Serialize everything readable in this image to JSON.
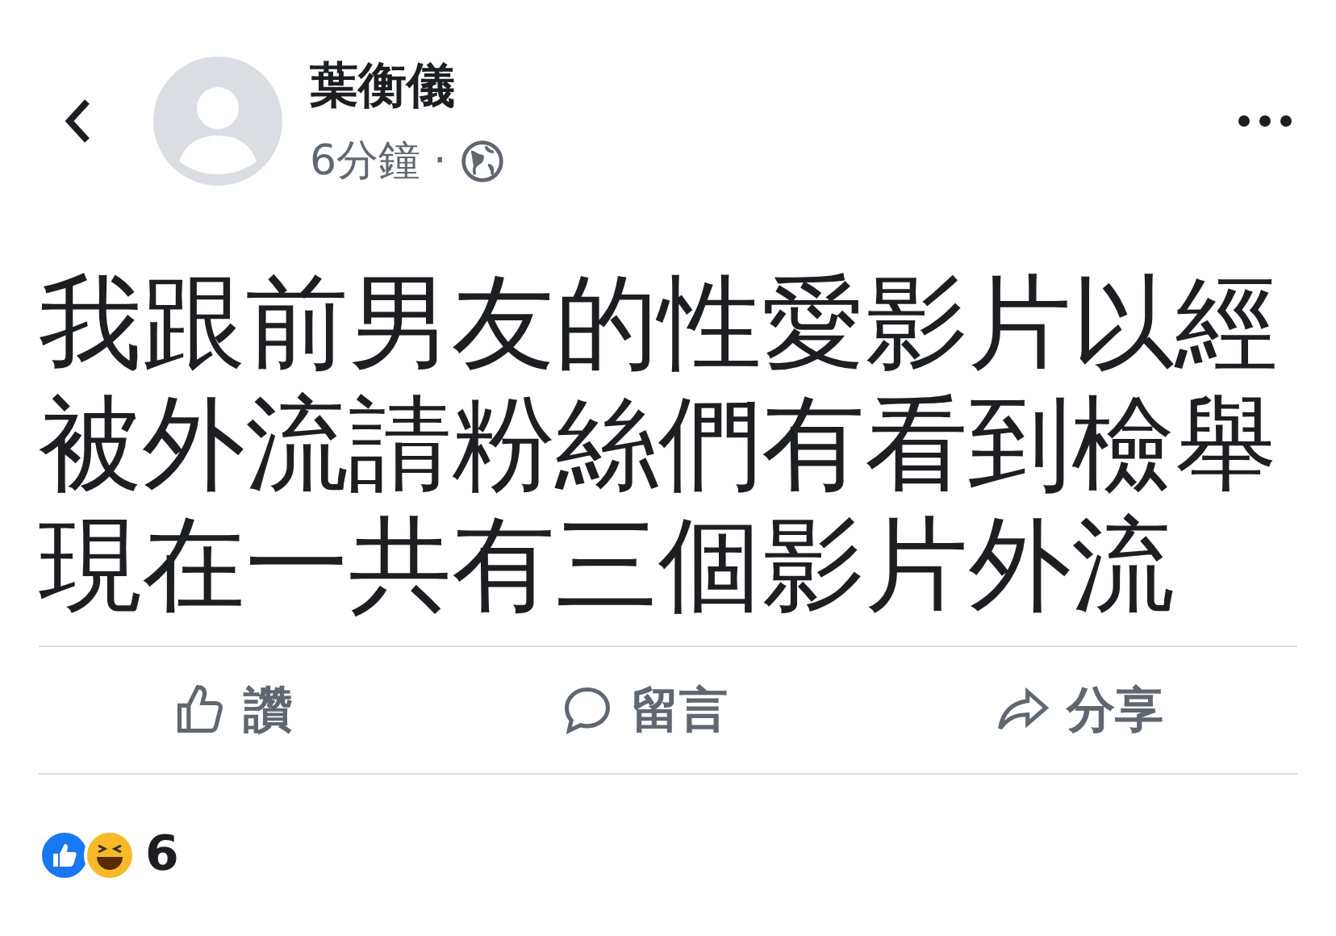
{
  "header": {
    "author": "葉衡儀",
    "time": "6分鐘",
    "separator": "·"
  },
  "post": {
    "lines": [
      "我跟前男友的性愛影片以經",
      "被外流請粉絲們有看到檢舉",
      "現在一共有三個影片外流"
    ]
  },
  "actions": [
    {
      "kind": "like",
      "label": "讚"
    },
    {
      "kind": "comment",
      "label": "留言"
    },
    {
      "kind": "share",
      "label": "分享"
    }
  ],
  "reactions": {
    "types": [
      {
        "kind": "like"
      },
      {
        "kind": "haha"
      }
    ],
    "count": "6"
  }
}
